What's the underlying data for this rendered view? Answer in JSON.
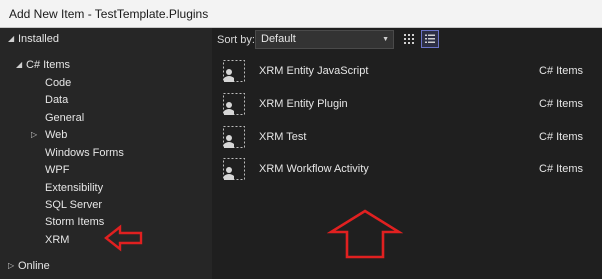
{
  "window": {
    "title": "Add New Item - TestTemplate.Plugins"
  },
  "tree": {
    "installed_label": "Installed",
    "csharp_items_label": "C# Items",
    "children": [
      {
        "label": "Code",
        "has_arrow": false
      },
      {
        "label": "Data",
        "has_arrow": false
      },
      {
        "label": "General",
        "has_arrow": false
      },
      {
        "label": "Web",
        "has_arrow": true
      },
      {
        "label": "Windows Forms",
        "has_arrow": false
      },
      {
        "label": "WPF",
        "has_arrow": false
      },
      {
        "label": "Extensibility",
        "has_arrow": false
      },
      {
        "label": "SQL Server",
        "has_arrow": false
      },
      {
        "label": "Storm Items",
        "has_arrow": false
      },
      {
        "label": "XRM",
        "has_arrow": false
      }
    ],
    "online_label": "Online"
  },
  "toolbar": {
    "sort_by_label": "Sort by:",
    "sort_value": "Default",
    "view_grid_icon": "grid-view-icon",
    "view_list_icon": "list-view-icon",
    "selected_view": "list"
  },
  "items": [
    {
      "name": "XRM Entity JavaScript",
      "category": "C# Items"
    },
    {
      "name": "XRM Entity Plugin",
      "category": "C# Items"
    },
    {
      "name": "XRM Test",
      "category": "C# Items"
    },
    {
      "name": "XRM Workflow Activity",
      "category": "C# Items"
    }
  ],
  "annotations": {
    "color": "#e02020",
    "left_arrow_icon": "red-left-arrow-icon",
    "up_arrow_icon": "red-up-arrow-icon"
  }
}
